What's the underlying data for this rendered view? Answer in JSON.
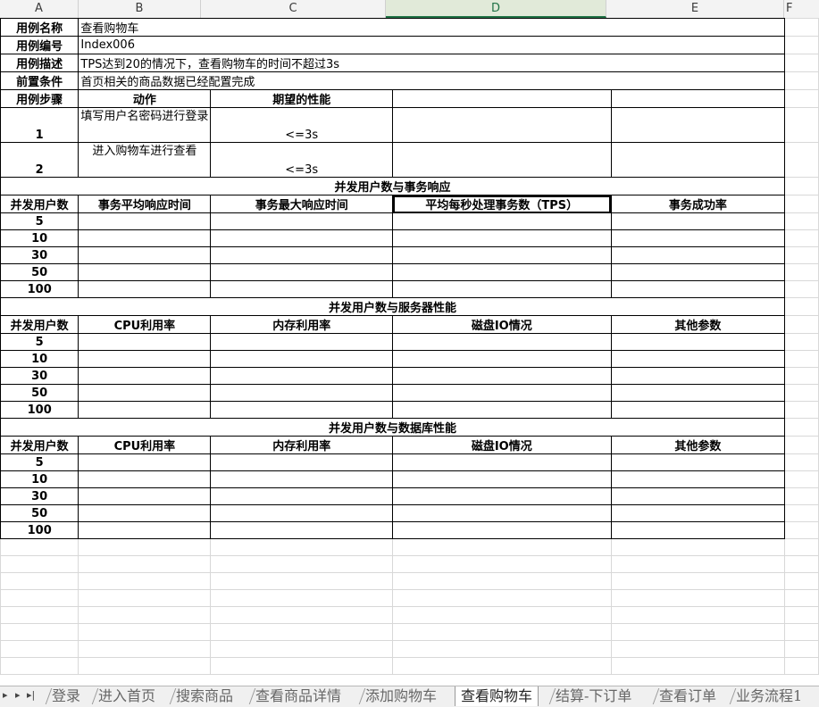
{
  "columns": [
    "A",
    "B",
    "C",
    "D",
    "E",
    "F"
  ],
  "meta": {
    "name_label": "用例名称",
    "name_value": "查看购物车",
    "id_label": "用例编号",
    "id_value": "Index006",
    "desc_label": "用例描述",
    "desc_value": "TPS达到20的情况下，查看购物车的时间不超过3s",
    "pre_label": "前置条件",
    "pre_value": "首页相关的商品数据已经配置完成"
  },
  "steps": {
    "header": [
      "用例步骤",
      "动作",
      "期望的性能"
    ],
    "rows": [
      {
        "no": "1",
        "action": "填写用户名密码进行登录",
        "expect": "<=3s"
      },
      {
        "no": "2",
        "action": "进入购物车进行查看",
        "expect": "<=3s"
      }
    ]
  },
  "section1": {
    "title": "并发用户数与事务响应",
    "headers": [
      "并发用户数",
      "事务平均响应时间",
      "事务最大响应时间",
      "平均每秒处理事务数（TPS）",
      "事务成功率"
    ],
    "users": [
      "5",
      "10",
      "30",
      "50",
      "100"
    ]
  },
  "section2": {
    "title": "并发用户数与服务器性能",
    "headers": [
      "并发用户数",
      "CPU利用率",
      "内存利用率",
      "磁盘IO情况",
      "其他参数"
    ],
    "users": [
      "5",
      "10",
      "30",
      "50",
      "100"
    ]
  },
  "section3": {
    "title": "并发用户数与数据库性能",
    "headers": [
      "并发用户数",
      "CPU利用率",
      "内存利用率",
      "磁盘IO情况",
      "其他参数"
    ],
    "users": [
      "5",
      "10",
      "30",
      "50",
      "100"
    ]
  },
  "tabs": [
    "登录",
    "进入首页",
    "搜索商品",
    "查看商品详情",
    "添加购物车",
    "查看购物车",
    "结算-下订单",
    "查看订单",
    "业务流程1"
  ],
  "active_tab": "查看购物车"
}
